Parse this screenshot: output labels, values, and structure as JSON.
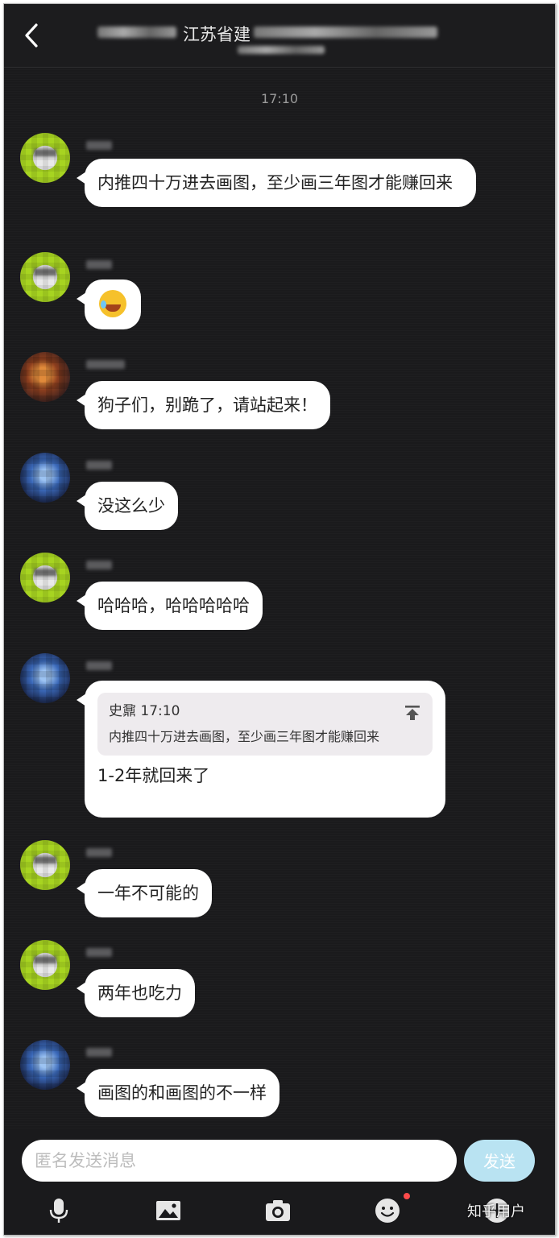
{
  "header": {
    "title": "江苏省建",
    "back_icon": "chevron-left-icon"
  },
  "timestamp": "17:10",
  "messages": [
    {
      "avatar": "green",
      "text": "内推四十万进去画图，至少画三年图才能赚回来"
    },
    {
      "avatar": "green",
      "emoji": "laughing-crying-emoji"
    },
    {
      "avatar": "orange",
      "text": "狗子们，别跪了，请站起来！"
    },
    {
      "avatar": "blue",
      "text": "没这么少"
    },
    {
      "avatar": "green",
      "text": "哈哈哈，哈哈哈哈哈"
    },
    {
      "avatar": "blue",
      "quote": {
        "sender": "史鼐",
        "time": "17:10",
        "text": "内推四十万进去画图，至少画三年图才能赚回来"
      },
      "text": "1-2年就回来了"
    },
    {
      "avatar": "green",
      "text": "一年不可能的"
    },
    {
      "avatar": "green",
      "text": "两年也吃力"
    },
    {
      "avatar": "blue",
      "text": "画图的和画图的不一样"
    }
  ],
  "composer": {
    "placeholder": "匿名发送消息",
    "send_label": "发送"
  },
  "toolbar": {
    "icons": [
      "microphone-icon",
      "image-icon",
      "camera-icon",
      "emoji-icon",
      "plus-icon"
    ],
    "emoji_has_notification": true
  },
  "watermark": "知乎用户",
  "colors": {
    "background": "#1a1a1c",
    "bubble": "#ffffff",
    "send_button": "#b9e3f2",
    "notification_dot": "#ff4b4b"
  }
}
